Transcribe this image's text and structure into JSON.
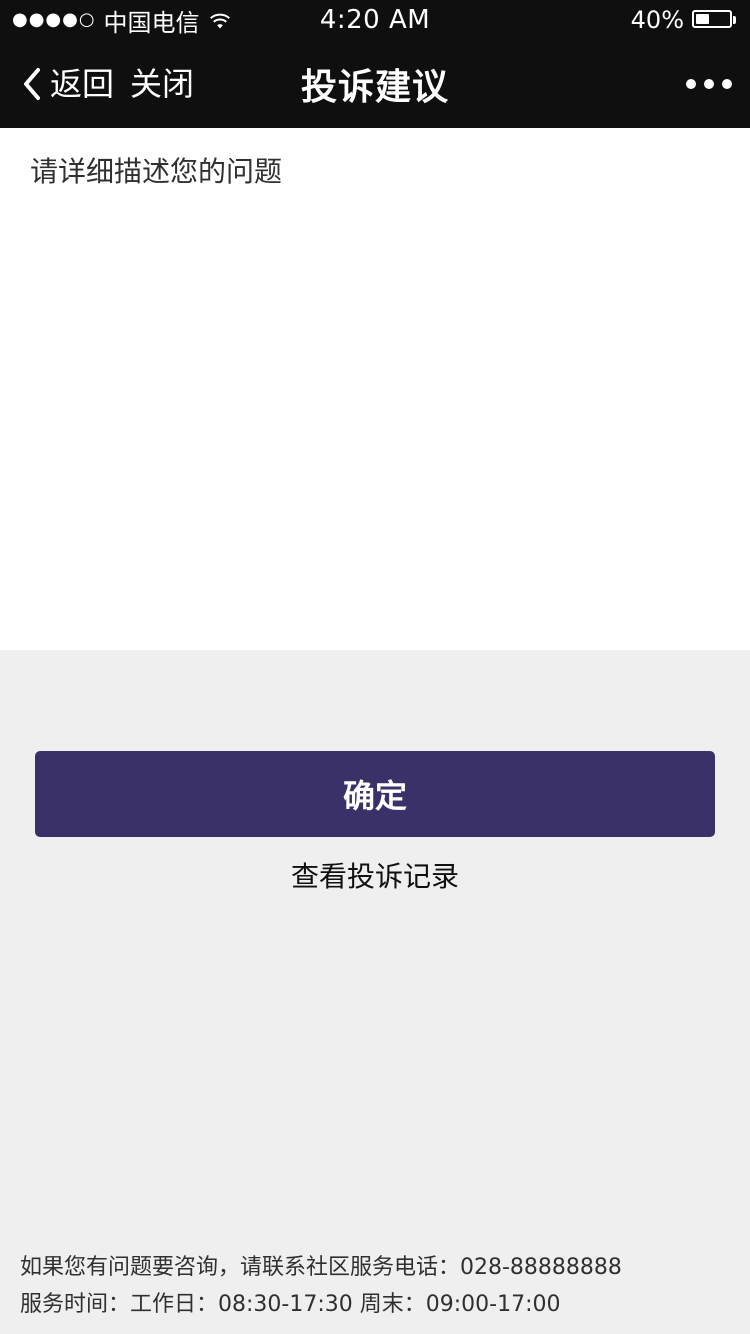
{
  "status_bar": {
    "carrier": "中国电信",
    "signal_dots": "●●●●○",
    "time": "4:20 AM",
    "battery_percent": "40%",
    "battery_level": 0.4
  },
  "nav": {
    "back_label": "返回",
    "close_label": "关闭",
    "title": "投诉建议"
  },
  "content": {
    "textarea_placeholder": "请详细描述您的问题"
  },
  "actions": {
    "confirm_label": "确定",
    "records_label": "查看投诉记录"
  },
  "footer": {
    "contact_line": "如果您有问题要咨询，请联系社区服务电话：028-88888888",
    "hours_line": "服务时间：工作日：08:30-17:30    周末：09:00-17:00"
  },
  "colors": {
    "primary": "#3A3168",
    "text_primary": "#303030",
    "text_link": "#101010",
    "background": "#EFEFF0",
    "topbar": "#0F0F0F"
  },
  "icons": {
    "back": "chevron-left-icon",
    "more": "more-horizontal-icon",
    "wifi": "wifi-icon",
    "battery": "battery-icon"
  }
}
